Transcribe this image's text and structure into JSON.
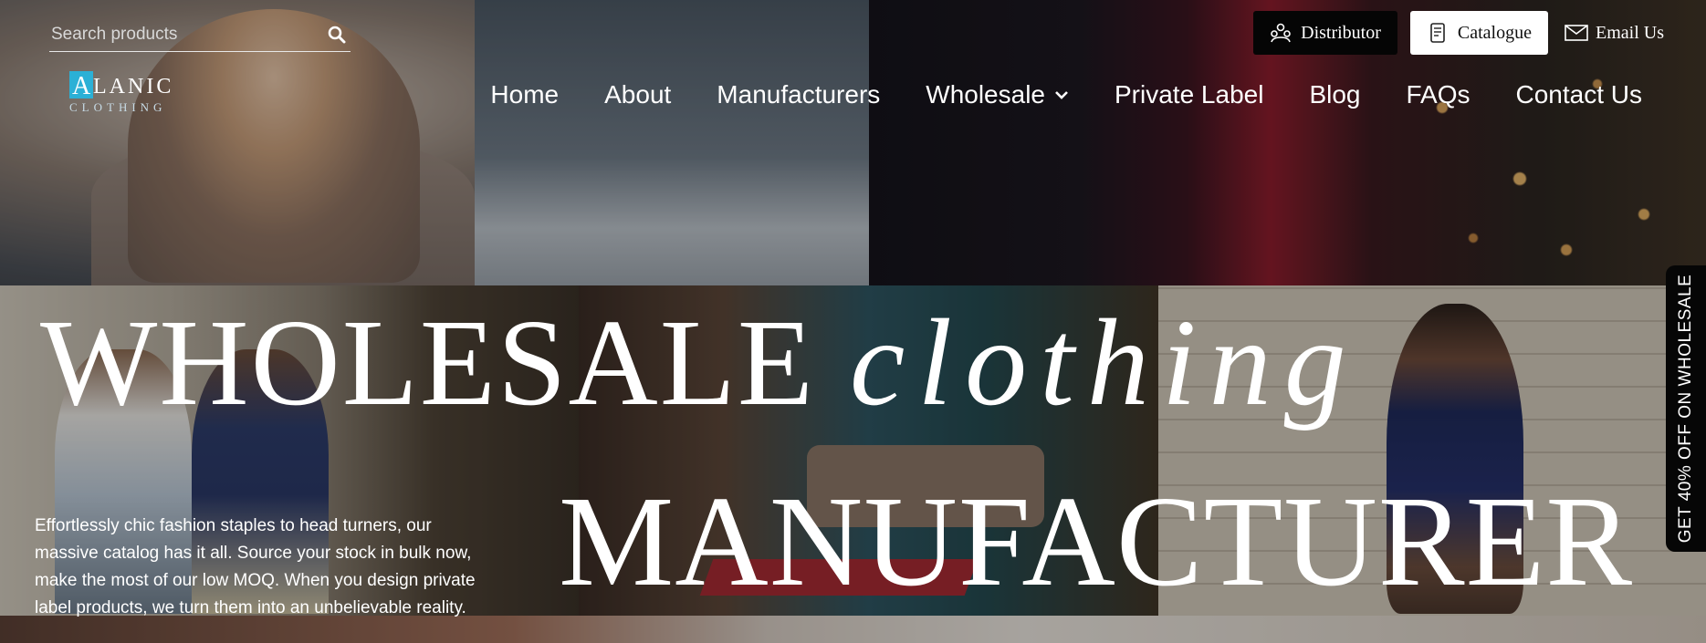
{
  "search": {
    "placeholder": "Search products",
    "value": ""
  },
  "logo": {
    "letter": "A",
    "brand": "LANIC",
    "sub": "CLOTHING"
  },
  "top_buttons": {
    "distributor": "Distributor",
    "catalogue": "Catalogue",
    "email": "Email Us"
  },
  "nav": {
    "items": [
      "Home",
      "About",
      "Manufacturers",
      "Wholesale",
      "Private Label",
      "Blog",
      "FAQs",
      "Contact Us"
    ]
  },
  "hero": {
    "line1_main": "WHOLESALE",
    "line1_script": "clothing",
    "line2": "MANUFACTURER",
    "description": "Effortlessly chic fashion staples to head turners, our massive catalog has it all. Source your stock in bulk now, make the most of our low MOQ. When you design private label products, we turn them into an unbelievable reality."
  },
  "side_tab": {
    "label": "GET 40% OFF ON WHOLESALE"
  },
  "icons": {
    "search": "search-icon",
    "distributor": "distributor-icon",
    "catalogue": "catalogue-icon",
    "email": "envelope-icon",
    "dropdown": "chevron-down-icon"
  },
  "colors": {
    "logo_accent": "#2bb0d6",
    "dark_button": "#050505",
    "light_button": "#ffffff"
  }
}
